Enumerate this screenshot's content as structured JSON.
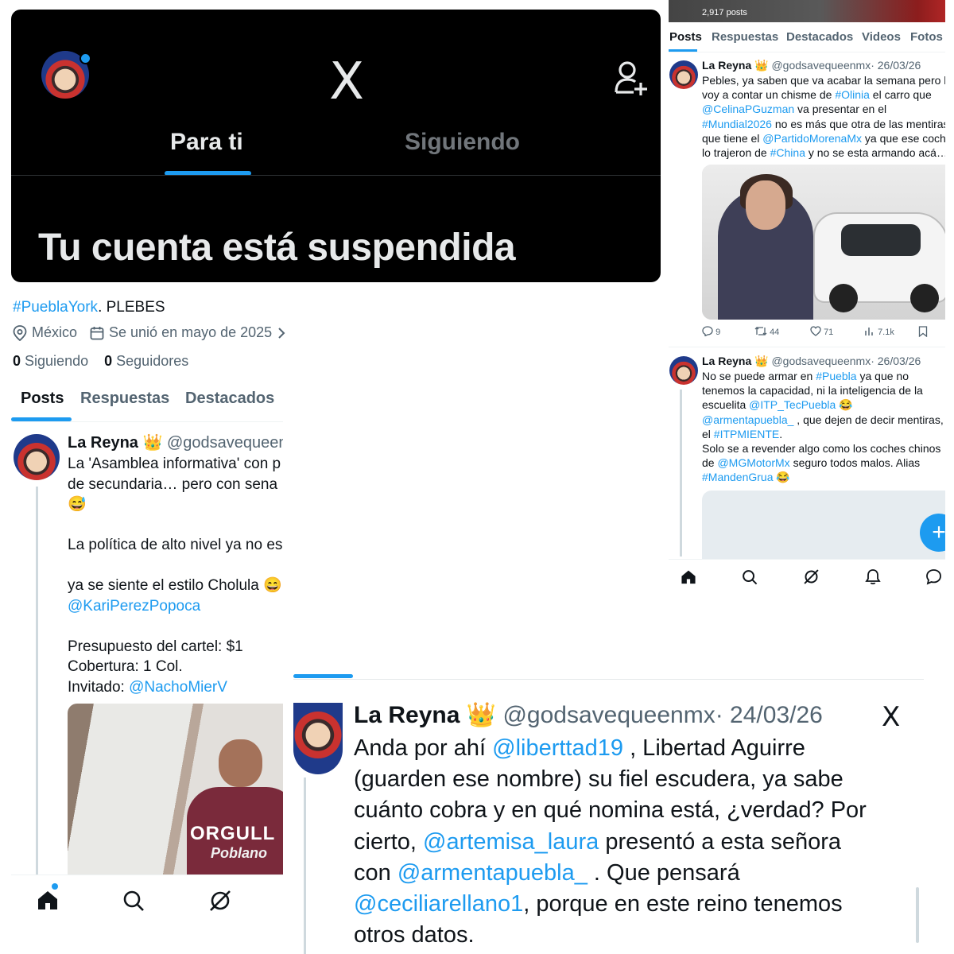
{
  "panel1": {
    "header": {
      "logo": "X",
      "tabs": [
        "Para ti",
        "Siguiendo"
      ],
      "banner": "Tu cuenta está suspendida"
    },
    "profile": {
      "bio_hashtag": "#PueblaYork",
      "bio_rest": ". PLEBES",
      "location": "México",
      "joined": "Se unió en mayo de 2025",
      "following_count": "0",
      "following_label": "Siguiendo",
      "followers_count": "0",
      "followers_label": "Seguidores",
      "tabs": [
        "Posts",
        "Respuestas",
        "Destacados"
      ]
    },
    "post": {
      "name": "La Reyna",
      "crown": "👑",
      "handle": "@godsavequeen",
      "lines": [
        "La 'Asamblea informativa' con p",
        "de secundaria… pero con sena",
        "😅",
        "",
        "La política de alto nivel ya no es",
        "",
        "ya se siente el estilo Cholula 😄",
        "@KariPerezPopoca",
        "",
        "Presupuesto del cartel: $1",
        "Cobertura: 1 Col.",
        "Invitado: @NachoMierV"
      ],
      "mention1": "@KariPerezPopoca",
      "invitado_label": "Invitado: ",
      "invitado_mention": "@NachoMierV",
      "image_text1": "ORGULL",
      "image_text2": "Poblano"
    }
  },
  "panel2": {
    "posts_count": "2,917 posts",
    "tabs": [
      "Posts",
      "Respuestas",
      "Destacados",
      "Videos",
      "Fotos"
    ],
    "post1": {
      "name": "La Reyna",
      "crown": "👑",
      "handle": "@godsavequeenmx",
      "date": "· 26/03/26",
      "l1": "Pebles, ya saben que va acabar la semana pero le",
      "l2a": "voy a contar un chisme de ",
      "l2b": "#Olinia",
      "l2c": " el carro que",
      "l3a": "@CelinaPGuzman",
      "l3b": " va presentar en el",
      "l4a": "#Mundial2026",
      "l4b": " no es más que otra de las mentiras",
      "l5a": "que tiene el ",
      "l5b": "@PartidoMorenaMx",
      "l5c": " ya que ese coche",
      "l6a": "lo trajeron de ",
      "l6b": "#China",
      "l6c": " y no se esta armando acá…",
      "replies": "9",
      "reposts": "44",
      "likes": "71",
      "views": "7.1k"
    },
    "post2": {
      "name": "La Reyna",
      "crown": "👑",
      "handle": "@godsavequeenmx",
      "date": "· 26/03/26",
      "l1a": "No se puede armar en ",
      "l1b": "#Puebla",
      "l1c": " ya que no",
      "l2": "tenemos la capacidad, ni la inteligencia de la",
      "l3a": "escuelita ",
      "l3b": "@ITP_TecPuebla",
      "l3c": " 😂",
      "l4a": "@armentapuebla_",
      "l4b": " , que dejen de decir mentiras,",
      "l5a": "el ",
      "l5b": "#ITPMIENTE",
      "l5c": ".",
      "l6": "Solo se a revender algo como los coches chinos",
      "l7a": "de ",
      "l7b": "@MGMotorMx",
      "l7c": " seguro todos malos. Alias",
      "l8a": "#MandenGrua",
      "l8b": " 😂"
    }
  },
  "panel3": {
    "name": "La Reyna",
    "crown": "👑",
    "handle": "@godsavequeenmx",
    "date": "· 24/03/26",
    "logo": "X",
    "l1a": "Anda por ahí ",
    "l1b": "@liberttad19",
    "l1c": " , Libertad Aguirre",
    "l2": "(guarden ese nombre) su fiel escudera, ya sabe",
    "l3": "cuánto cobra y en qué nomina está, ¿verdad? Por",
    "l4a": "cierto, ",
    "l4b": "@artemisa_laura",
    "l4c": " presentó a esta señora",
    "l5a": "con ",
    "l5b": "@armentapuebla_",
    "l5c": " . Que pensará",
    "l6a": "@ceciliarellano1",
    "l6b": ", porque en este reino tenemos",
    "l7": "otros datos."
  },
  "icons": {
    "accent": "#1d9bf0",
    "names": [
      "home-icon",
      "search-icon",
      "grok-icon",
      "bell-icon",
      "message-icon",
      "add-user-icon",
      "calendar-icon",
      "location-icon",
      "reply-icon",
      "repost-icon",
      "like-icon",
      "views-icon",
      "bookmark-icon",
      "chevron-right-icon",
      "x-logo-icon"
    ]
  }
}
